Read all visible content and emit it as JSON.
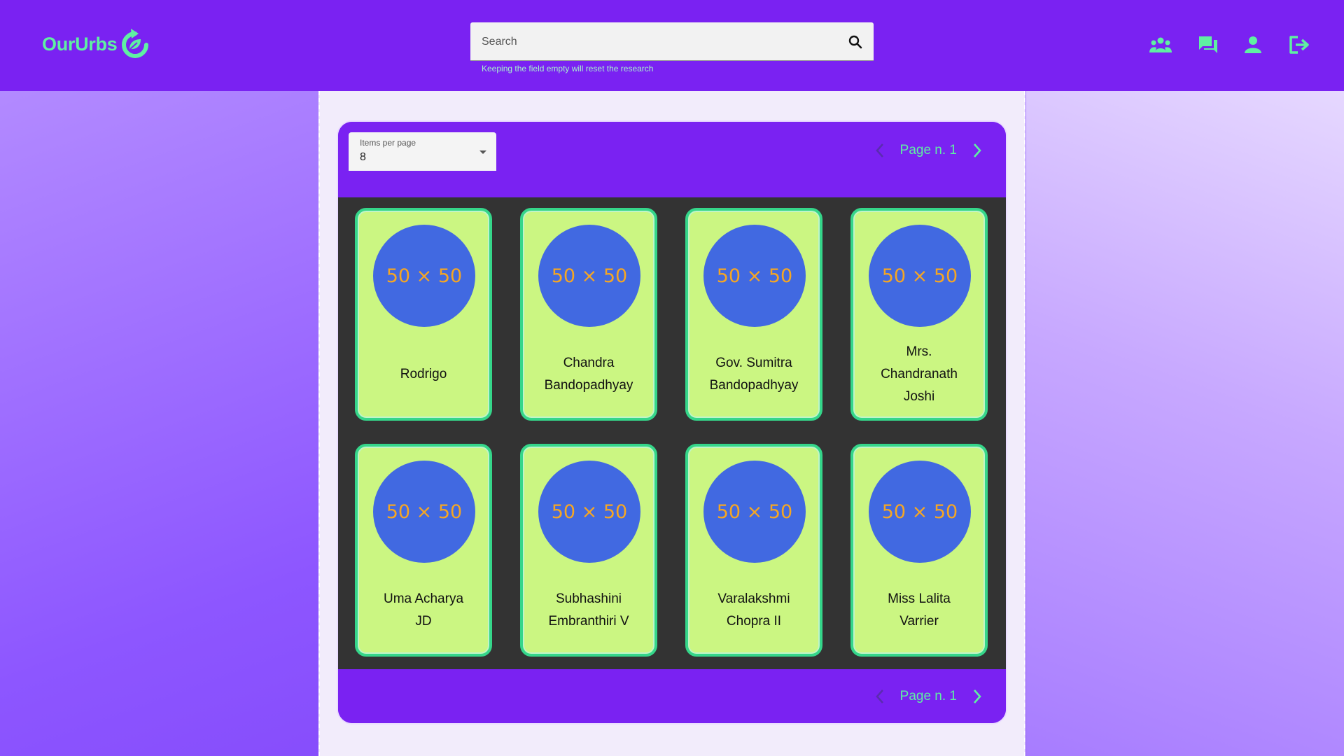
{
  "app": {
    "name": "OurUrbs"
  },
  "search": {
    "placeholder": "Search",
    "hint": "Keeping the field empty will reset the research"
  },
  "nav": {
    "icons": [
      "groups-icon",
      "forum-icon",
      "person-icon",
      "logout-icon"
    ]
  },
  "pager": {
    "items_per_page_label": "Items per page",
    "items_per_page_value": "8",
    "page_label": "Page n. 1"
  },
  "colors": {
    "header": "#7a22f2",
    "accent": "#5ff0a2",
    "card_bg": "#cbf682",
    "card_border": "#35d68a",
    "avatar_bg": "#4169e1",
    "avatar_text": "#f5a623",
    "grid_bg": "#333333"
  },
  "cards": [
    {
      "avatar": "50 × 50",
      "name": "Rodrigo"
    },
    {
      "avatar": "50 × 50",
      "name": "Chandra Bandopadhyay"
    },
    {
      "avatar": "50 × 50",
      "name": "Gov. Sumitra Bandopadhyay"
    },
    {
      "avatar": "50 × 50",
      "name": "Mrs. Chandranath Joshi"
    },
    {
      "avatar": "50 × 50",
      "name": "Uma Acharya JD"
    },
    {
      "avatar": "50 × 50",
      "name": "Subhashini Embranthiri V"
    },
    {
      "avatar": "50 × 50",
      "name": "Varalakshmi Chopra II"
    },
    {
      "avatar": "50 × 50",
      "name": "Miss Lalita Varrier"
    }
  ]
}
